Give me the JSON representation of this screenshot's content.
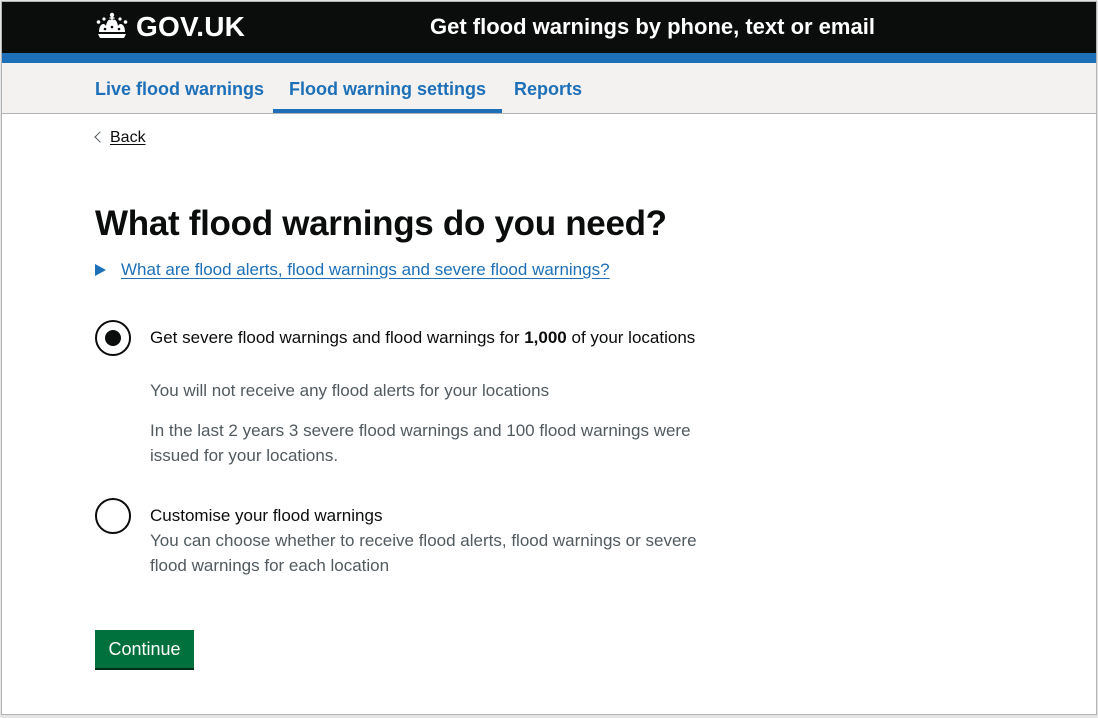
{
  "header": {
    "logo_text": "GOV.UK",
    "service_name": "Get flood warnings by phone, text or email",
    "colors": {
      "bar": "#0b0c0c",
      "accent": "#1d70b8"
    }
  },
  "nav": {
    "items": [
      {
        "label": "Live flood warnings",
        "active": false
      },
      {
        "label": "Flood warning settings",
        "active": true
      },
      {
        "label": "Reports",
        "active": false
      }
    ]
  },
  "back_link": {
    "label": "Back"
  },
  "page": {
    "heading": "What flood warnings do you need?",
    "details_summary": "What are flood alerts, flood warnings and severe flood warnings?"
  },
  "options": [
    {
      "selected": true,
      "label_prefix": "Get severe flood warnings and flood warnings for ",
      "label_bold": "1,000",
      "label_suffix": " of your locations",
      "hint": "You will not receive any flood alerts for your locations",
      "hint_extra": "In the last 2 years 3 severe flood warnings and 100 flood warnings were issued for your locations."
    },
    {
      "selected": false,
      "label": "Customise your flood warnings",
      "hint": "You can choose whether to receive flood alerts, flood warnings or severe flood warnings for each location"
    }
  ],
  "continue_button": {
    "label": "Continue",
    "color": "#00703c"
  }
}
